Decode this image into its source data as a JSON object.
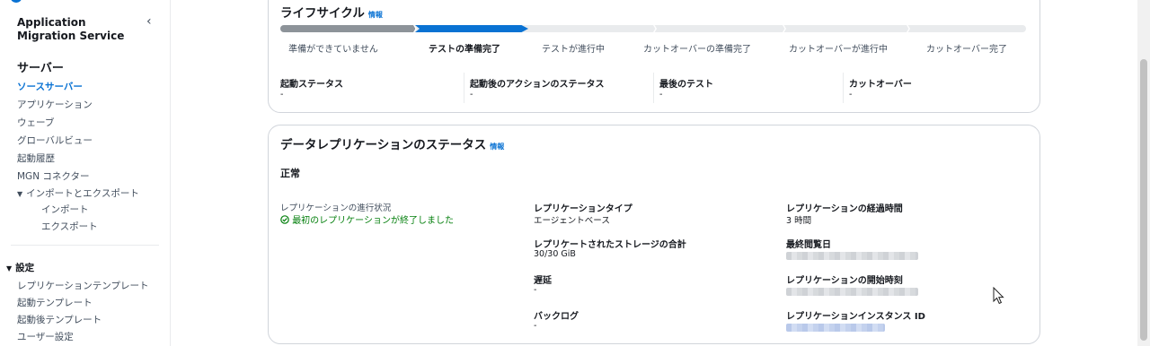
{
  "sidebar": {
    "title": "Application Migration Service",
    "collapse_icon": "chevron-left-icon",
    "section": "サーバー",
    "items": [
      {
        "label": "ソースサーバー",
        "active": true
      },
      {
        "label": "アプリケーション"
      },
      {
        "label": "ウェーブ"
      },
      {
        "label": "グローバルビュー"
      },
      {
        "label": "起動履歴"
      },
      {
        "label": "MGN コネクター"
      },
      {
        "label": "インポートとエクスポート"
      },
      {
        "label": "インポート"
      },
      {
        "label": "エクスポート"
      }
    ],
    "settings": {
      "label": "設定",
      "items": [
        "レプリケーションテンプレート",
        "起動テンプレート",
        "起動後テンプレート",
        "ユーザー設定"
      ]
    }
  },
  "lifecycle": {
    "title": "ライフサイクル",
    "info": "情報",
    "steps": [
      "準備ができていません",
      "テストの準備完了",
      "テストが進行中",
      "カットオーバーの準備完了",
      "カットオーバーが進行中",
      "カットオーバー完了"
    ],
    "current_step": 2,
    "fields": [
      {
        "label": "起動ステータス",
        "value": "-"
      },
      {
        "label": "起動後のアクションのステータス",
        "value": "-"
      },
      {
        "label": "最後のテスト",
        "value": "-"
      },
      {
        "label": "カットオーバー",
        "value": "-"
      }
    ]
  },
  "replication": {
    "title": "データレプリケーションのステータス",
    "info": "情報",
    "status": "正常",
    "progress_label": "レプリケーションの進行状況",
    "progress_value": "最初のレプリケーションが終了しました",
    "progress_icon": "check-circle-icon",
    "progress_color": "#037f0c",
    "col2": [
      {
        "label": "レプリケーションタイプ",
        "value": "エージェントベース"
      },
      {
        "label": "レプリケートされたストレージの合計",
        "value": "30/30 GiB"
      },
      {
        "label": "遅延",
        "value": "-"
      },
      {
        "label": "バックログ",
        "value": "-"
      }
    ],
    "col3": [
      {
        "label": "レプリケーションの経過時間",
        "value": "3 時間"
      },
      {
        "label": "最終閲覧日",
        "value": ""
      },
      {
        "label": "レプリケーションの開始時刻",
        "value": ""
      },
      {
        "label": "レプリケーションインスタンス ID",
        "value": ""
      }
    ]
  },
  "colors": {
    "accent": "#0972d3",
    "success": "#037f0c"
  }
}
